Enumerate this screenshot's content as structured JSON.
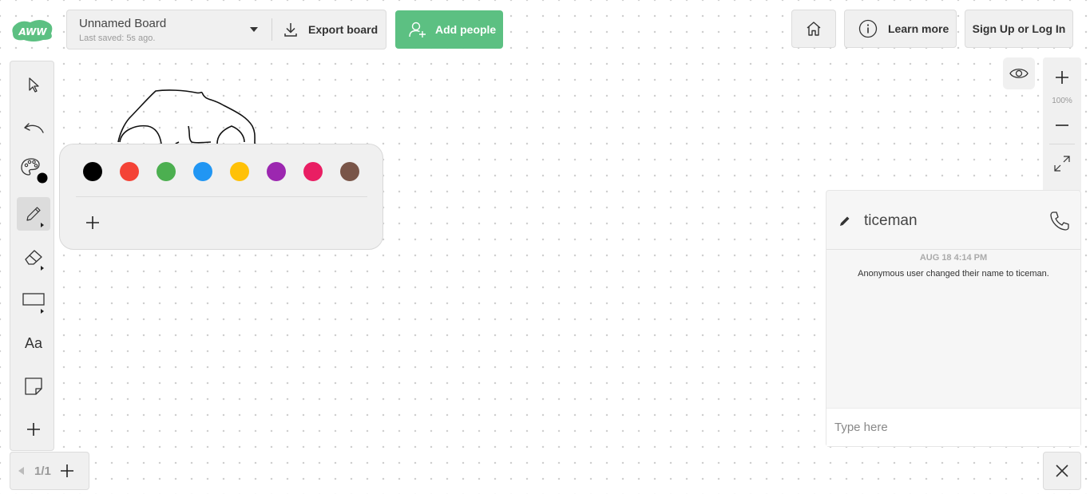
{
  "header": {
    "logo_text": "AWW",
    "board_name": "Unnamed Board",
    "last_saved": "Last saved: 5s ago.",
    "export_label": "Export board",
    "add_people_label": "Add people",
    "learn_more_label": "Learn more",
    "signup_label": "Sign Up or Log In"
  },
  "toolbar": {
    "items": [
      {
        "name": "select",
        "icon": "cursor-icon"
      },
      {
        "name": "undo",
        "icon": "undo-icon"
      },
      {
        "name": "color-palette",
        "icon": "palette-icon",
        "current_color": "#000000"
      },
      {
        "name": "pencil",
        "icon": "pencil-icon",
        "active": true
      },
      {
        "name": "eraser",
        "icon": "eraser-icon"
      },
      {
        "name": "shapes",
        "icon": "rectangle-icon"
      },
      {
        "name": "text",
        "icon": "text-icon",
        "label": "Aa"
      },
      {
        "name": "sticky-note",
        "icon": "sticky-note-icon"
      },
      {
        "name": "more",
        "icon": "plus-icon"
      }
    ]
  },
  "palette": {
    "colors": [
      "#000000",
      "#f44336",
      "#4caf50",
      "#2196f3",
      "#ffc107",
      "#9c27b0",
      "#e91e63",
      "#795548"
    ]
  },
  "page_nav": {
    "current": "1/1"
  },
  "zoom": {
    "level": "100%"
  },
  "chat": {
    "username": "ticeman",
    "timestamp": "AUG 18 4:14 PM",
    "message": "Anonymous user changed their name to ticeman.",
    "input_placeholder": "Type here"
  },
  "colors": {
    "accent_green": "#5cc082",
    "panel_bg": "#f0f0f0"
  }
}
